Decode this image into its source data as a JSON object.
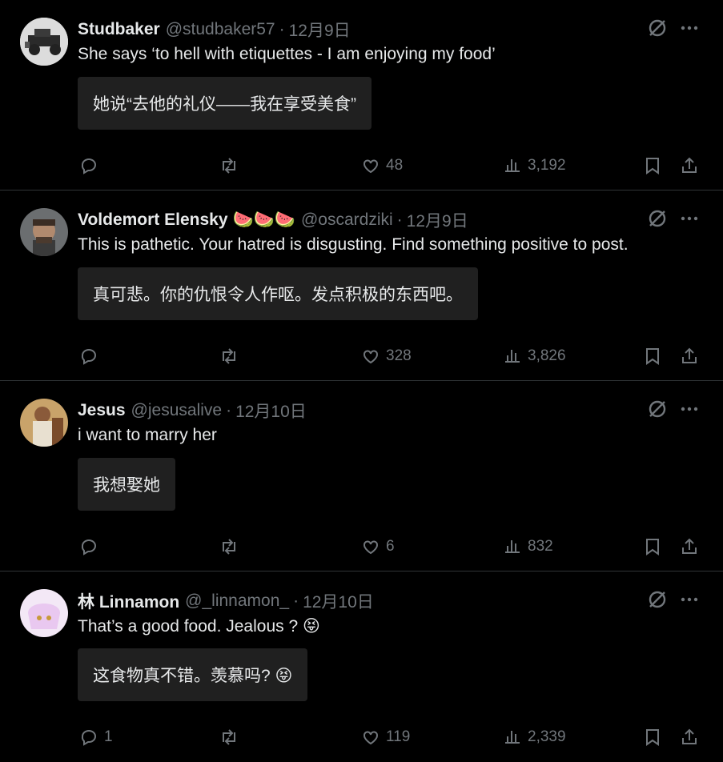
{
  "tweets": [
    {
      "name": "Studbaker",
      "handle": "@studbaker57",
      "date": "12月9日",
      "text": "She says ‘to hell with etiquettes - I am enjoying my food’",
      "translation": "她说“去他的礼仪——我在享受美食”",
      "replies": "",
      "likes": "48",
      "views": "3,192"
    },
    {
      "name": "Voldemort Elensky",
      "handle": "@oscardziki",
      "date": "12月9日",
      "badge_emojis": "🍉🍉🍉",
      "text": "This is pathetic. Your hatred is disgusting. Find something positive to post.",
      "translation": "真可悲。你的仇恨令人作呕。发点积极的东西吧。",
      "replies": "",
      "likes": "328",
      "views": "3,826"
    },
    {
      "name": "Jesus",
      "handle": "@jesusalive",
      "date": "12月10日",
      "text": "i want to marry her",
      "translation": "我想娶她",
      "replies": "",
      "likes": "6",
      "views": "832"
    },
    {
      "name": "林 Linnamon",
      "handle": "@_linnamon_",
      "date": "12月10日",
      "text": "That’s a good food. Jealous ? 😝",
      "translation": "这食物真不错。羡慕吗? 😝",
      "replies": "1",
      "likes": "119",
      "views": "2,339"
    }
  ],
  "icons": {
    "reply": "reply-icon",
    "retweet": "retweet-icon",
    "like": "heart-icon",
    "views": "views-icon",
    "bookmark": "bookmark-icon",
    "share": "share-icon",
    "grok": "grok-icon",
    "more": "more-icon"
  }
}
